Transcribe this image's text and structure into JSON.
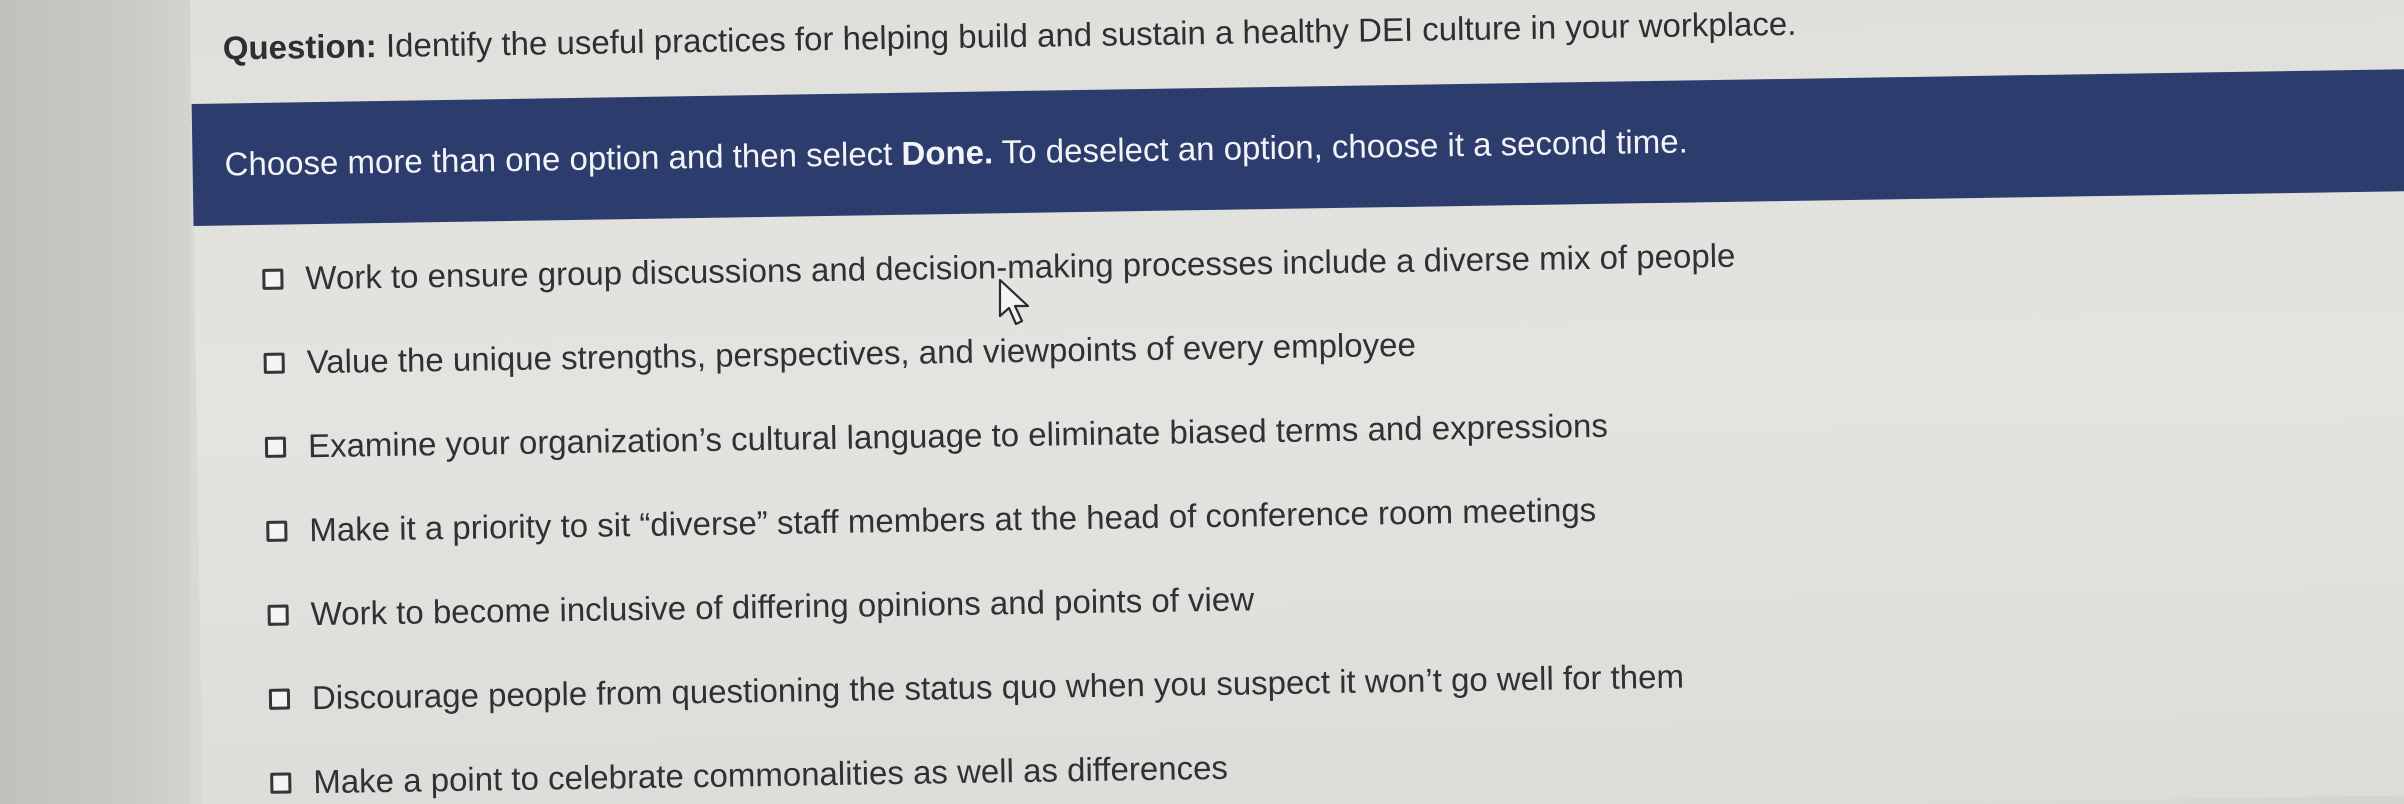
{
  "question": {
    "label": "Question:",
    "text": "Identify the useful practices for helping build and sustain a healthy DEI culture in your workplace."
  },
  "instruction": {
    "before": "Choose more than one option and then select ",
    "done": "Done.",
    "after": " To deselect an option, choose it a second time."
  },
  "options": [
    {
      "label": "Work to ensure group discussions and decision-making processes include a diverse mix of people",
      "checked": false
    },
    {
      "label": "Value the unique strengths, perspectives, and viewpoints of every employee",
      "checked": false
    },
    {
      "label": "Examine your organization’s cultural language to eliminate biased terms and expressions",
      "checked": false
    },
    {
      "label": "Make it a priority to sit “diverse” staff members at the head of conference room meetings",
      "checked": false
    },
    {
      "label": "Work to become inclusive of differing opinions and points of view",
      "checked": false
    },
    {
      "label": "Discourage people from questioning the status quo when you suspect it won’t go well for them",
      "checked": false
    },
    {
      "label": "Make a point to celebrate commonalities as well as differences",
      "checked": false
    }
  ],
  "icons": {
    "checkbox": "checkbox-icon",
    "cursor": "mouse-pointer-icon"
  },
  "colors": {
    "banner": "#2c3c6c",
    "text": "#2d2f33",
    "banner_text": "#f3f4f7"
  }
}
